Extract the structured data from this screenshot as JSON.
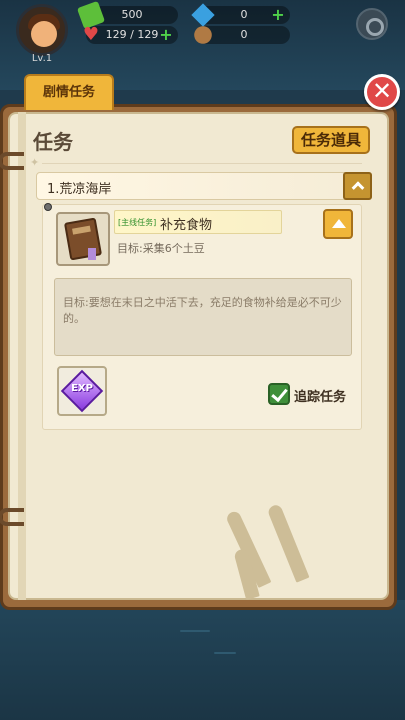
{
  "hud": {
    "level": "Lv.1",
    "cash": "500",
    "gems": "0",
    "health": "129 / 129",
    "potatoes": "0",
    "plus_symbol": "+"
  },
  "tab": {
    "label": "剧情任务"
  },
  "close_symbol": "✕",
  "panel": {
    "title": "任务",
    "items_button": "任务道具",
    "star": "✦"
  },
  "chapter": {
    "label": "1.荒凉海岸"
  },
  "quest": {
    "tag": "[主线任务]",
    "name": "补充食物",
    "goal": "目标:采集6个土豆",
    "description": "目标:要想在末日之中活下去，充足的食物补给是必不可少的。",
    "reward_label": "EXP",
    "track_label": "追踪任务",
    "tracking": true
  },
  "colors": {
    "accent": "#f0b63a",
    "close": "#e04848",
    "tag_green": "#2f8f2b",
    "reward_purple": "#8b3ce0"
  },
  "icons": [
    "avatar",
    "cash-icon",
    "gem-icon",
    "heart-icon",
    "potato-icon",
    "gear-icon",
    "close-icon",
    "chevron-up-icon",
    "quest-book-icon",
    "exp-gem-icon",
    "checkbox-icon"
  ]
}
